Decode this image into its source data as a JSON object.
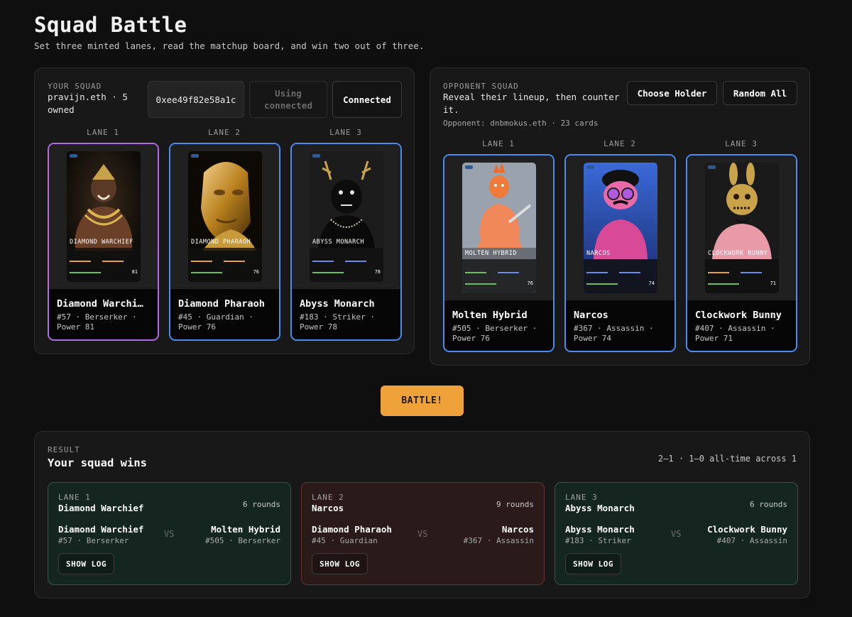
{
  "header": {
    "title": "Squad Battle",
    "subtitle": "Set three minted lanes, read the matchup board, and win two out of three."
  },
  "your_squad": {
    "label": "YOUR SQUAD",
    "owner_line1": "pravijn.eth · 5",
    "owner_line2": "owned",
    "address_button": "0xee49f82e58a1c",
    "using_line1": "Using",
    "using_line2": "connected",
    "connected_button": "Connected",
    "lanes": [
      {
        "lane": "LANE 1",
        "name": "Diamond Warchi…",
        "mini_name": "DIAMOND WARCHIEF",
        "id_class": "#57 · Berserker ·",
        "power": "Power 81",
        "mini_power": "81",
        "accent": "#b16ae8"
      },
      {
        "lane": "LANE 2",
        "name": "Diamond Pharaoh",
        "mini_name": "DIAMOND PHARAOH",
        "id_class": "#45 · Guardian ·",
        "power": "Power 76",
        "mini_power": "76",
        "accent": "#4a8cf0"
      },
      {
        "lane": "LANE 3",
        "name": "Abyss Monarch",
        "mini_name": "ABYSS MONARCH",
        "id_class": "#183 · Striker ·",
        "power": "Power 78",
        "mini_power": "78",
        "accent": "#4a8cf0"
      }
    ]
  },
  "opponent_squad": {
    "label": "OPPONENT SQUAD",
    "desc_line1": "Reveal their lineup, then counter",
    "desc_line2": "it.",
    "opponent_line": "Opponent: dnbmokus.eth · 23 cards",
    "choose_holder_button": "Choose Holder",
    "random_all_button": "Random All",
    "lanes": [
      {
        "lane": "LANE 1",
        "name": "Molten Hybrid",
        "mini_name": "MOLTEN HYBRID",
        "id_class": "#505 · Berserker ·",
        "power": "Power 76",
        "mini_power": "76"
      },
      {
        "lane": "LANE 2",
        "name": "Narcos",
        "mini_name": "NARCOS",
        "id_class": "#367 · Assassin ·",
        "power": "Power 74",
        "mini_power": "74"
      },
      {
        "lane": "LANE 3",
        "name": "Clockwork Bunny",
        "mini_name": "CLOCKWORK BUNNY",
        "id_class": "#407 · Assassin ·",
        "power": "Power 71",
        "mini_power": "71"
      }
    ]
  },
  "battle_button": "BATTLE!",
  "result": {
    "label": "RESULT",
    "headline": "Your squad wins",
    "score": "2–1 · 1–0 all-time across 1",
    "vs_label": "VS",
    "show_log_label": "SHOW LOG",
    "lanes": [
      {
        "lane": "LANE 1",
        "winner": "Diamond Warchief",
        "rounds": "6 rounds",
        "outcome": "win",
        "left_name": "Diamond Warchief",
        "left_meta": "#57 · Berserker",
        "right_name": "Molten Hybrid",
        "right_meta": "#505 · Berserker"
      },
      {
        "lane": "LANE 2",
        "winner": "Narcos",
        "rounds": "9 rounds",
        "outcome": "loss",
        "left_name": "Diamond Pharaoh",
        "left_meta": "#45 · Guardian",
        "right_name": "Narcos",
        "right_meta": "#367 · Assassin"
      },
      {
        "lane": "LANE 3",
        "winner": "Abyss Monarch",
        "rounds": "6 rounds",
        "outcome": "win",
        "left_name": "Abyss Monarch",
        "left_meta": "#183 · Striker",
        "right_name": "Clockwork Bunny",
        "right_meta": "#407 · Assassin"
      }
    ]
  },
  "colors": {
    "accent_orange": "#f0a23a",
    "card_border_blue": "#4a8cf0",
    "card_border_purple": "#b16ae8",
    "win_bg": "#14261f",
    "loss_bg": "#2a1a1a"
  }
}
